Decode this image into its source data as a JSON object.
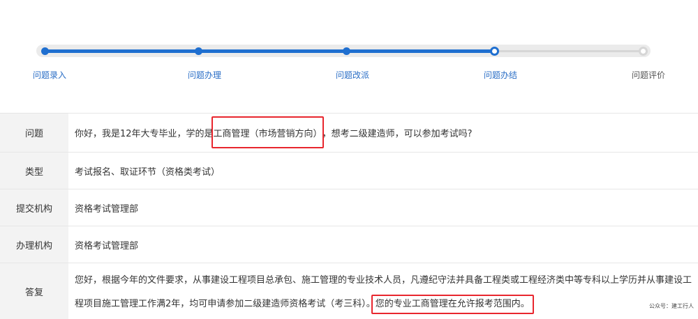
{
  "steps": [
    {
      "label": "问题录入",
      "state": "done"
    },
    {
      "label": "问题办理",
      "state": "done"
    },
    {
      "label": "问题改派",
      "state": "done"
    },
    {
      "label": "问题办结",
      "state": "current"
    },
    {
      "label": "问题评价",
      "state": "pending"
    }
  ],
  "details": {
    "question": {
      "key": "问题",
      "pre": "你好，我是12年大专毕业，学的是",
      "highlight": "工商管理（市场营销方向）",
      "post": "，想考二级建造师，可以参加考试吗?"
    },
    "type": {
      "key": "类型",
      "value": "考试报名、取证环节（资格类考试）"
    },
    "submit_org": {
      "key": "提交机构",
      "value": "资格考试管理部"
    },
    "handle_org": {
      "key": "办理机构",
      "value": "资格考试管理部"
    },
    "answer": {
      "key": "答复",
      "text": "您好，根据今年的文件要求，从事建设工程项目总承包、施工管理的专业技术人员，凡遵纪守法并具备工程类或工程经济类中等专科以上学历并从事建设工程项目施工管理工作满2年，均可申请参加二级建造师资格考试（考三科）。",
      "highlight": "您的专业工商管理在允许报考范围内。"
    }
  },
  "watermark": "公众号：建工行人",
  "colors": {
    "accent": "#1f6fd0",
    "highlight_border": "#e8262e",
    "key_bg": "#f3f3f3"
  }
}
